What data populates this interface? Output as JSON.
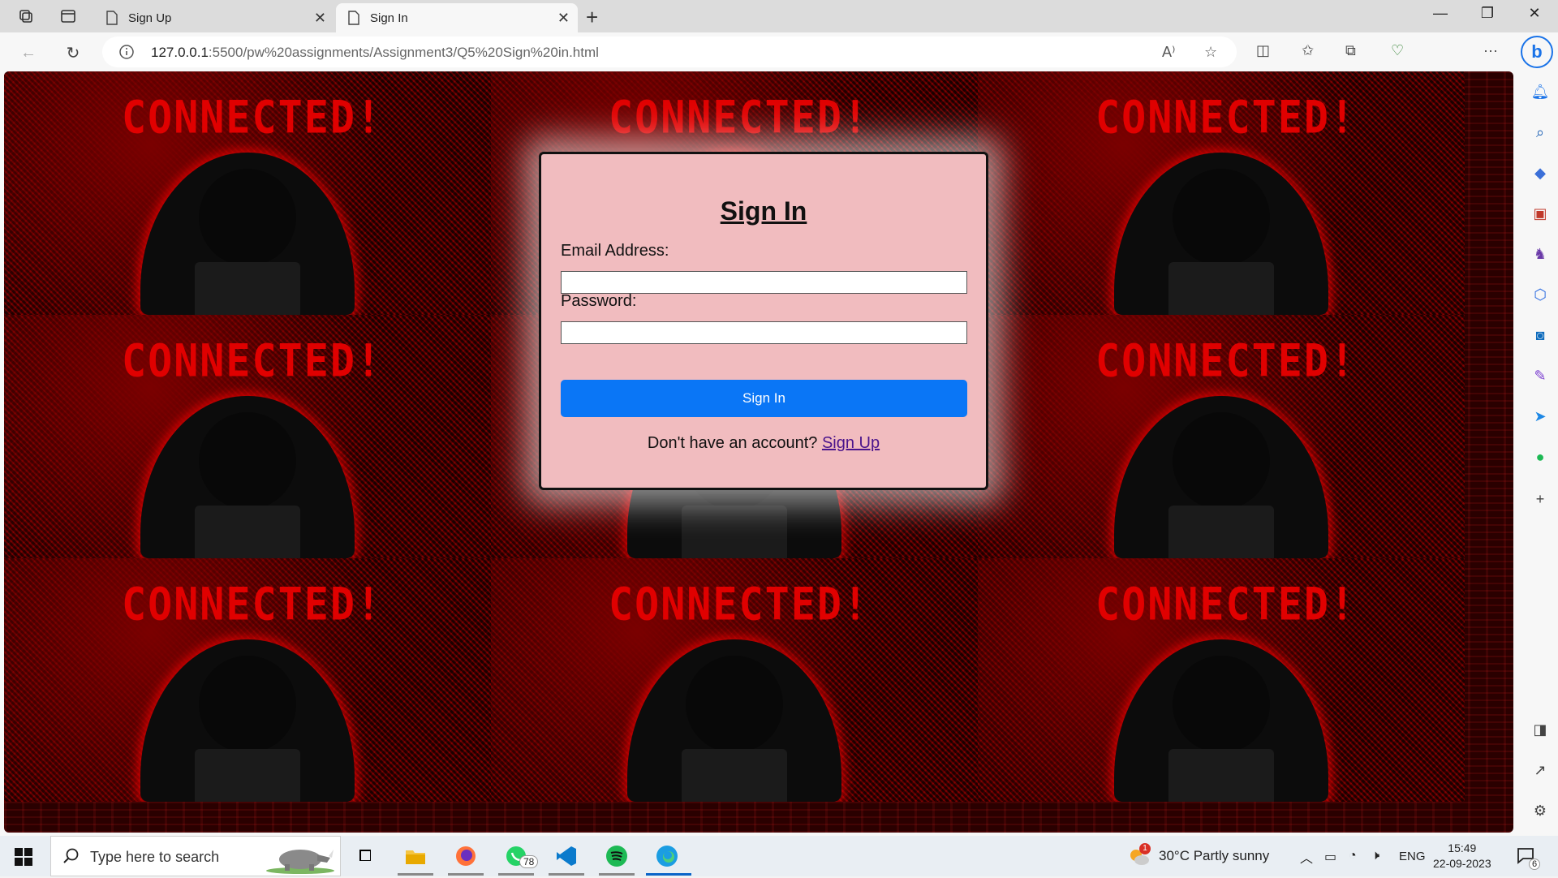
{
  "browser": {
    "tabs": [
      {
        "title": "Sign Up",
        "active": false
      },
      {
        "title": "Sign In",
        "active": true
      }
    ],
    "url_host": "127.0.0.1",
    "url_rest": ":5500/pw%20assignments/Assignment3/Q5%20Sign%20in.html"
  },
  "page": {
    "background_text": "CONNECTED!",
    "form": {
      "title": "Sign In",
      "email_label": "Email Address:",
      "email_value": "",
      "password_label": "Password:",
      "password_value": "",
      "submit_label": "Sign In",
      "footer_text": "Don't have an account? ",
      "footer_link": "Sign Up"
    }
  },
  "taskbar": {
    "search_placeholder": "Type here to search",
    "whatsapp_badge": "78",
    "weather_badge": "1",
    "weather": "30°C  Partly sunny",
    "language": "ENG",
    "time": "15:49",
    "date": "22-09-2023",
    "notification_count": "6"
  },
  "colors": {
    "card_bg": "#f1bcbf",
    "button_bg": "#0a76f6",
    "accent_red": "#e00000"
  }
}
